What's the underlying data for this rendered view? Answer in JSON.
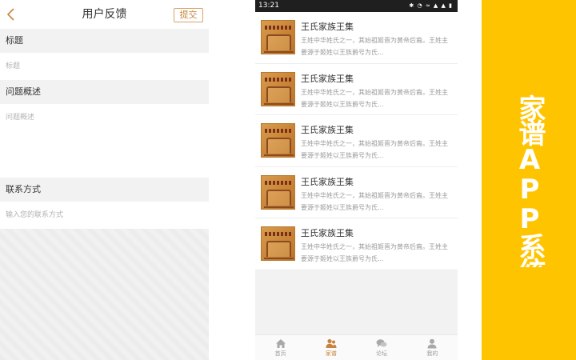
{
  "feedback": {
    "title": "用户反馈",
    "submit_label": "提交",
    "sections": {
      "title_label": "标题",
      "title_placeholder": "标题",
      "problem_label": "问题概述",
      "problem_placeholder": "问题概述",
      "contact_label": "联系方式",
      "contact_placeholder": "输入您的联系方式"
    }
  },
  "phone": {
    "status_time": "13:21",
    "status_icons": "✱ ◔ ≈ ▲ ▲ ▮",
    "items": [
      {
        "title": "王氏家族王集",
        "desc": "王姓中华姓氏之一，其始祖姬晋为黄帝后裔。王姓主要源于姬姓以王族爵号为氏..."
      },
      {
        "title": "王氏家族王集",
        "desc": "王姓中华姓氏之一，其始祖姬晋为黄帝后裔。王姓主要源于姬姓以王族爵号为氏..."
      },
      {
        "title": "王氏家族王集",
        "desc": "王姓中华姓氏之一，其始祖姬晋为黄帝后裔。王姓主要源于姬姓以王族爵号为氏..."
      },
      {
        "title": "王氏家族王集",
        "desc": "王姓中华姓氏之一，其始祖姬晋为黄帝后裔。王姓主要源于姬姓以王族爵号为氏..."
      },
      {
        "title": "王氏家族王集",
        "desc": "王姓中华姓氏之一，其始祖姬晋为黄帝后裔。王姓主要源于姬姓以王族爵号为氏..."
      }
    ],
    "tabs": [
      {
        "label": "首页",
        "icon": "home-icon"
      },
      {
        "label": "家谱",
        "icon": "family-icon",
        "active": true
      },
      {
        "label": "论坛",
        "icon": "forum-icon"
      },
      {
        "label": "我的",
        "icon": "user-icon"
      }
    ]
  },
  "banner": {
    "text": "家谱APP系统"
  },
  "colors": {
    "accent": "#c8843c",
    "banner": "#ffc400",
    "status_bar": "#1f1f1f"
  }
}
